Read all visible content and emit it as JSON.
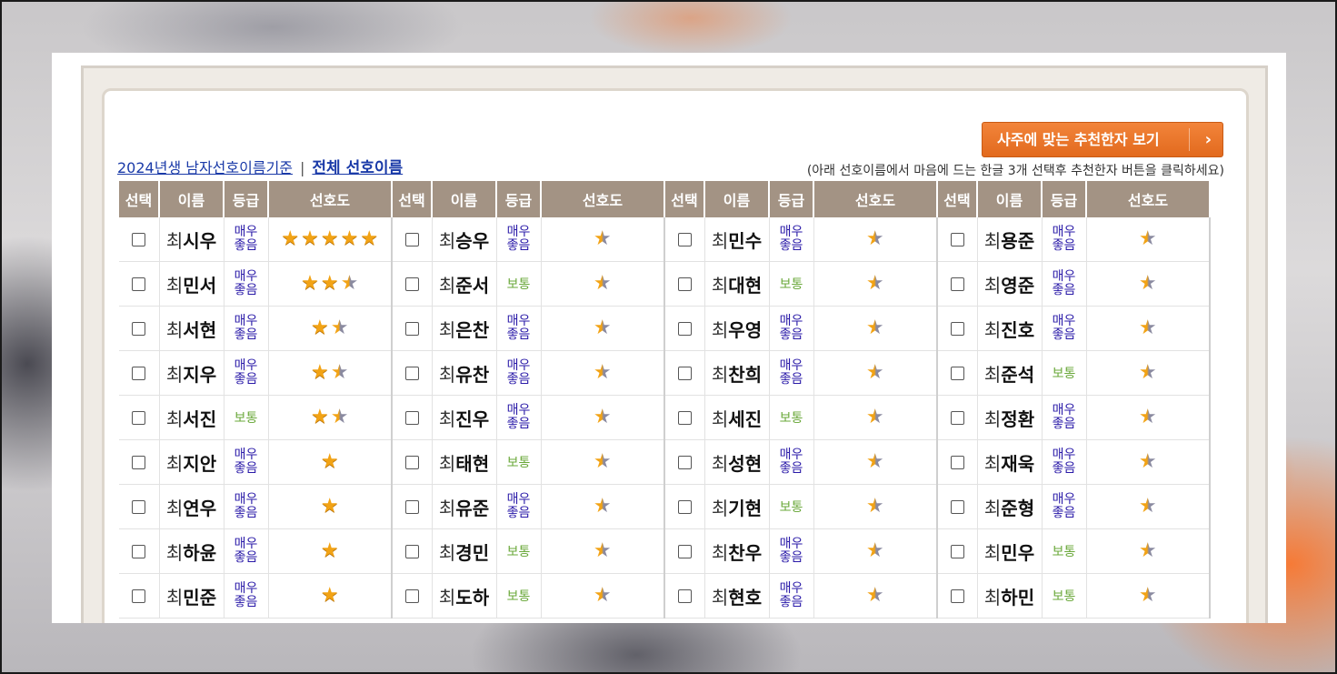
{
  "button": {
    "label": "사주에 맞는 추천한자 보기",
    "chevron": "›"
  },
  "links": {
    "left": "2024년생 남자선호이름기준",
    "separator": "|",
    "right": "전체 선호이름"
  },
  "hint": "(아래 선호이름에서 마음에 드는 한글 3개 선택후 추천한자 버튼을 클릭하세요)",
  "headers": {
    "select": "선택",
    "name": "이름",
    "grade": "등급",
    "pref": "선호도"
  },
  "surname": "최",
  "grade_labels": {
    "good": "매우좋음",
    "good_top": "매우",
    "good_bottom": "좋음",
    "normal": "보통"
  },
  "colors": {
    "header_bg": "#a39384",
    "button_bg": "#e97524",
    "good": "#2a1aa8",
    "normal": "#6aa83a",
    "star": "#f2a315"
  },
  "icons": {
    "star": "star-icon",
    "half_star": "half-star-icon",
    "chevron": "chevron-right-icon",
    "checkbox": "checkbox"
  },
  "groups": [
    {
      "rows": [
        {
          "given": "시우",
          "grade": "good",
          "stars": 5,
          "half": false
        },
        {
          "given": "민서",
          "grade": "good",
          "stars": 3,
          "half": true
        },
        {
          "given": "서현",
          "grade": "good",
          "stars": 2,
          "half": true
        },
        {
          "given": "지우",
          "grade": "good",
          "stars": 2,
          "half": true
        },
        {
          "given": "서진",
          "grade": "normal",
          "stars": 2,
          "half": true
        },
        {
          "given": "지안",
          "grade": "good",
          "stars": 1,
          "half": false
        },
        {
          "given": "연우",
          "grade": "good",
          "stars": 1,
          "half": false
        },
        {
          "given": "하윤",
          "grade": "good",
          "stars": 1,
          "half": false
        },
        {
          "given": "민준",
          "grade": "good",
          "stars": 1,
          "half": false
        }
      ]
    },
    {
      "rows": [
        {
          "given": "승우",
          "grade": "good",
          "stars": 1,
          "half": true
        },
        {
          "given": "준서",
          "grade": "normal",
          "stars": 1,
          "half": true
        },
        {
          "given": "은찬",
          "grade": "good",
          "stars": 1,
          "half": true
        },
        {
          "given": "유찬",
          "grade": "good",
          "stars": 1,
          "half": true
        },
        {
          "given": "진우",
          "grade": "good",
          "stars": 1,
          "half": true
        },
        {
          "given": "태현",
          "grade": "normal",
          "stars": 1,
          "half": true
        },
        {
          "given": "유준",
          "grade": "good",
          "stars": 1,
          "half": true
        },
        {
          "given": "경민",
          "grade": "normal",
          "stars": 1,
          "half": true
        },
        {
          "given": "도하",
          "grade": "normal",
          "stars": 1,
          "half": true
        }
      ]
    },
    {
      "rows": [
        {
          "given": "민수",
          "grade": "good",
          "stars": 1,
          "half": true
        },
        {
          "given": "대현",
          "grade": "normal",
          "stars": 1,
          "half": true
        },
        {
          "given": "우영",
          "grade": "good",
          "stars": 1,
          "half": true
        },
        {
          "given": "찬희",
          "grade": "good",
          "stars": 1,
          "half": true
        },
        {
          "given": "세진",
          "grade": "normal",
          "stars": 1,
          "half": true
        },
        {
          "given": "성현",
          "grade": "good",
          "stars": 1,
          "half": true
        },
        {
          "given": "기현",
          "grade": "normal",
          "stars": 1,
          "half": true
        },
        {
          "given": "찬우",
          "grade": "good",
          "stars": 1,
          "half": true
        },
        {
          "given": "현호",
          "grade": "good",
          "stars": 1,
          "half": true
        }
      ]
    },
    {
      "rows": [
        {
          "given": "용준",
          "grade": "good",
          "stars": 1,
          "half": true
        },
        {
          "given": "영준",
          "grade": "good",
          "stars": 1,
          "half": true
        },
        {
          "given": "진호",
          "grade": "good",
          "stars": 1,
          "half": true
        },
        {
          "given": "준석",
          "grade": "normal",
          "stars": 1,
          "half": true
        },
        {
          "given": "정환",
          "grade": "good",
          "stars": 1,
          "half": true
        },
        {
          "given": "재욱",
          "grade": "good",
          "stars": 1,
          "half": true
        },
        {
          "given": "준형",
          "grade": "good",
          "stars": 1,
          "half": true
        },
        {
          "given": "민우",
          "grade": "normal",
          "stars": 1,
          "half": true
        },
        {
          "given": "하민",
          "grade": "normal",
          "stars": 1,
          "half": true
        }
      ]
    }
  ]
}
